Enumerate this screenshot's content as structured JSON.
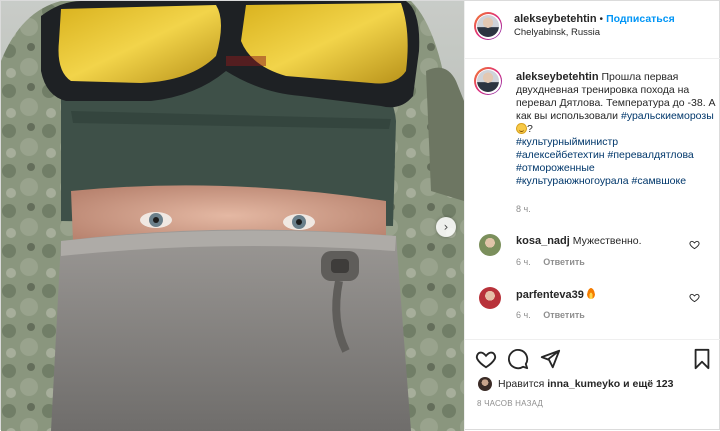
{
  "header": {
    "username": "alekseybetehtin",
    "separator": "•",
    "follow_label": "Подписаться",
    "location": "Chelyabinsk, Russia"
  },
  "caption": {
    "username": "alekseybetehtin",
    "text": "Прошла первая двухдневная тренировка похода на перевал Дятлова. Температура до -38. А как вы использовали",
    "hashtags": [
      "#уральскиеморозы",
      "#культурныйминистр",
      "#алексейбетехтин",
      "#перевалдятлова",
      "#отмороженные",
      "#культураюжногоурала",
      "#самвшоке"
    ],
    "question_mark": "?",
    "time": "8 ч."
  },
  "comments": [
    {
      "username": "kosa_nadj",
      "text": "Мужественно.",
      "time": "6 ч.",
      "reply_label": "Ответить"
    },
    {
      "username": "parfenteva39",
      "text": "",
      "time": "6 ч.",
      "reply_label": "Ответить"
    }
  ],
  "likes": {
    "prefix": "Нравится",
    "user": "inna_kumeyko",
    "suffix": "и ещё 123"
  },
  "timestamp": "8 ЧАСОВ НАЗАД",
  "icons": {
    "next": "chevron-right-icon",
    "like": "heart-icon",
    "comment": "comment-icon",
    "share": "paper-plane-icon",
    "save": "bookmark-icon"
  },
  "colors": {
    "follow": "#0095f6",
    "hashtag": "#00376b",
    "muted": "#8e8e8e",
    "text": "#262626"
  }
}
